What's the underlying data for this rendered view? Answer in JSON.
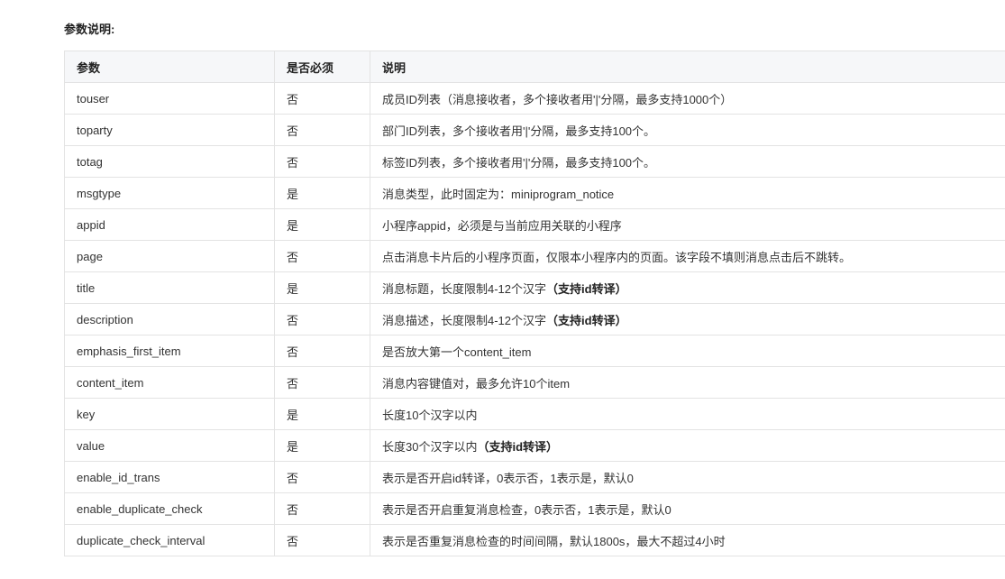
{
  "section_title": "参数说明:",
  "table": {
    "headers": {
      "param": "参数",
      "required": "是否必须",
      "desc": "说明"
    },
    "rows": [
      {
        "param": "touser",
        "required": "否",
        "desc": "成员ID列表（消息接收者，多个接收者用'|'分隔，最多支持1000个）",
        "note": ""
      },
      {
        "param": "toparty",
        "required": "否",
        "desc": "部门ID列表，多个接收者用'|'分隔，最多支持100个。",
        "note": ""
      },
      {
        "param": "totag",
        "required": "否",
        "desc": "标签ID列表，多个接收者用'|'分隔，最多支持100个。",
        "note": ""
      },
      {
        "param": "msgtype",
        "required": "是",
        "desc": "消息类型，此时固定为：miniprogram_notice",
        "note": ""
      },
      {
        "param": "appid",
        "required": "是",
        "desc": "小程序appid，必须是与当前应用关联的小程序",
        "note": ""
      },
      {
        "param": "page",
        "required": "否",
        "desc": "点击消息卡片后的小程序页面，仅限本小程序内的页面。该字段不填则消息点击后不跳转。",
        "note": ""
      },
      {
        "param": "title",
        "required": "是",
        "desc": "消息标题，长度限制4-12个汉字",
        "note": "（支持id转译）"
      },
      {
        "param": "description",
        "required": "否",
        "desc": "消息描述，长度限制4-12个汉字",
        "note": "（支持id转译）"
      },
      {
        "param": "emphasis_first_item",
        "required": "否",
        "desc": "是否放大第一个content_item",
        "note": ""
      },
      {
        "param": "content_item",
        "required": "否",
        "desc": "消息内容键值对，最多允许10个item",
        "note": ""
      },
      {
        "param": "key",
        "required": "是",
        "desc": "长度10个汉字以内",
        "note": ""
      },
      {
        "param": "value",
        "required": "是",
        "desc": "长度30个汉字以内",
        "note": "（支持id转译）"
      },
      {
        "param": "enable_id_trans",
        "required": "否",
        "desc": "表示是否开启id转译，0表示否，1表示是，默认0",
        "note": ""
      },
      {
        "param": "enable_duplicate_check",
        "required": "否",
        "desc": "表示是否开启重复消息检查，0表示否，1表示是，默认0",
        "note": ""
      },
      {
        "param": "duplicate_check_interval",
        "required": "否",
        "desc": "表示是否重复消息检查的时间间隔，默认1800s，最大不超过4小时",
        "note": ""
      }
    ]
  }
}
